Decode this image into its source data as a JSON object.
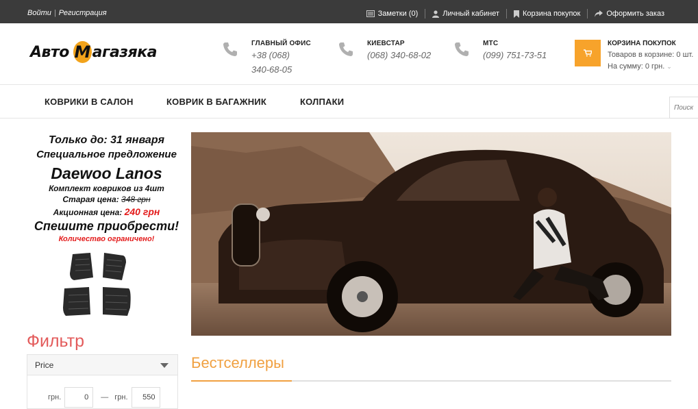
{
  "topbar": {
    "login": "Войти",
    "register": "Регистрация",
    "notes": "Заметки (0)",
    "account": "Личный кабинет",
    "cart": "Корзина покупок",
    "checkout": "Оформить заказ"
  },
  "logo": {
    "left": "Авто",
    "m": "М",
    "right": "агазяка"
  },
  "contacts": [
    {
      "title": "ГЛАВНЫЙ ОФИС",
      "line1": "+38 (068)",
      "line2": "340-68-05"
    },
    {
      "title": "КИЕВСТАР",
      "line1": "(068) 340-68-02",
      "line2": ""
    },
    {
      "title": "МТС",
      "line1": "(099) 751-73-51",
      "line2": ""
    }
  ],
  "cart": {
    "title": "КОРЗИНА ПОКУПОК",
    "items": "Товаров в корзине: 0 шт.",
    "sum": "На сумму: 0 грн."
  },
  "nav": {
    "item1": "КОВРИКИ В САЛОН",
    "item2": "КОВРИК В БАГАЖНИК",
    "item3": "КОЛПАКИ"
  },
  "search": {
    "placeholder": "Поиск"
  },
  "promo": {
    "date_prefix": "Только до: ",
    "date": "31 января",
    "special": "Специальное предложение",
    "model": "Daewoo Lanos",
    "set": "Комплект ковриков из 4шт",
    "old_label": "Старая цена: ",
    "old_price": "348 грн",
    "new_label": "Акционная цена: ",
    "new_price": "240 грн",
    "hurry": "Спешите приобрести!",
    "limited": "Количество ограничено!"
  },
  "filter": {
    "title": "Фильтр",
    "section": "Price",
    "from_label": "грн.",
    "from_value": "0",
    "to_label": "грн.",
    "to_value": "550"
  },
  "bestsellers": "Бестселлеры",
  "colors": {
    "accent": "#f7a32b",
    "topbar": "#3b3b3b",
    "filter_title": "#e35b5b",
    "promo_red": "#e31b1b"
  }
}
